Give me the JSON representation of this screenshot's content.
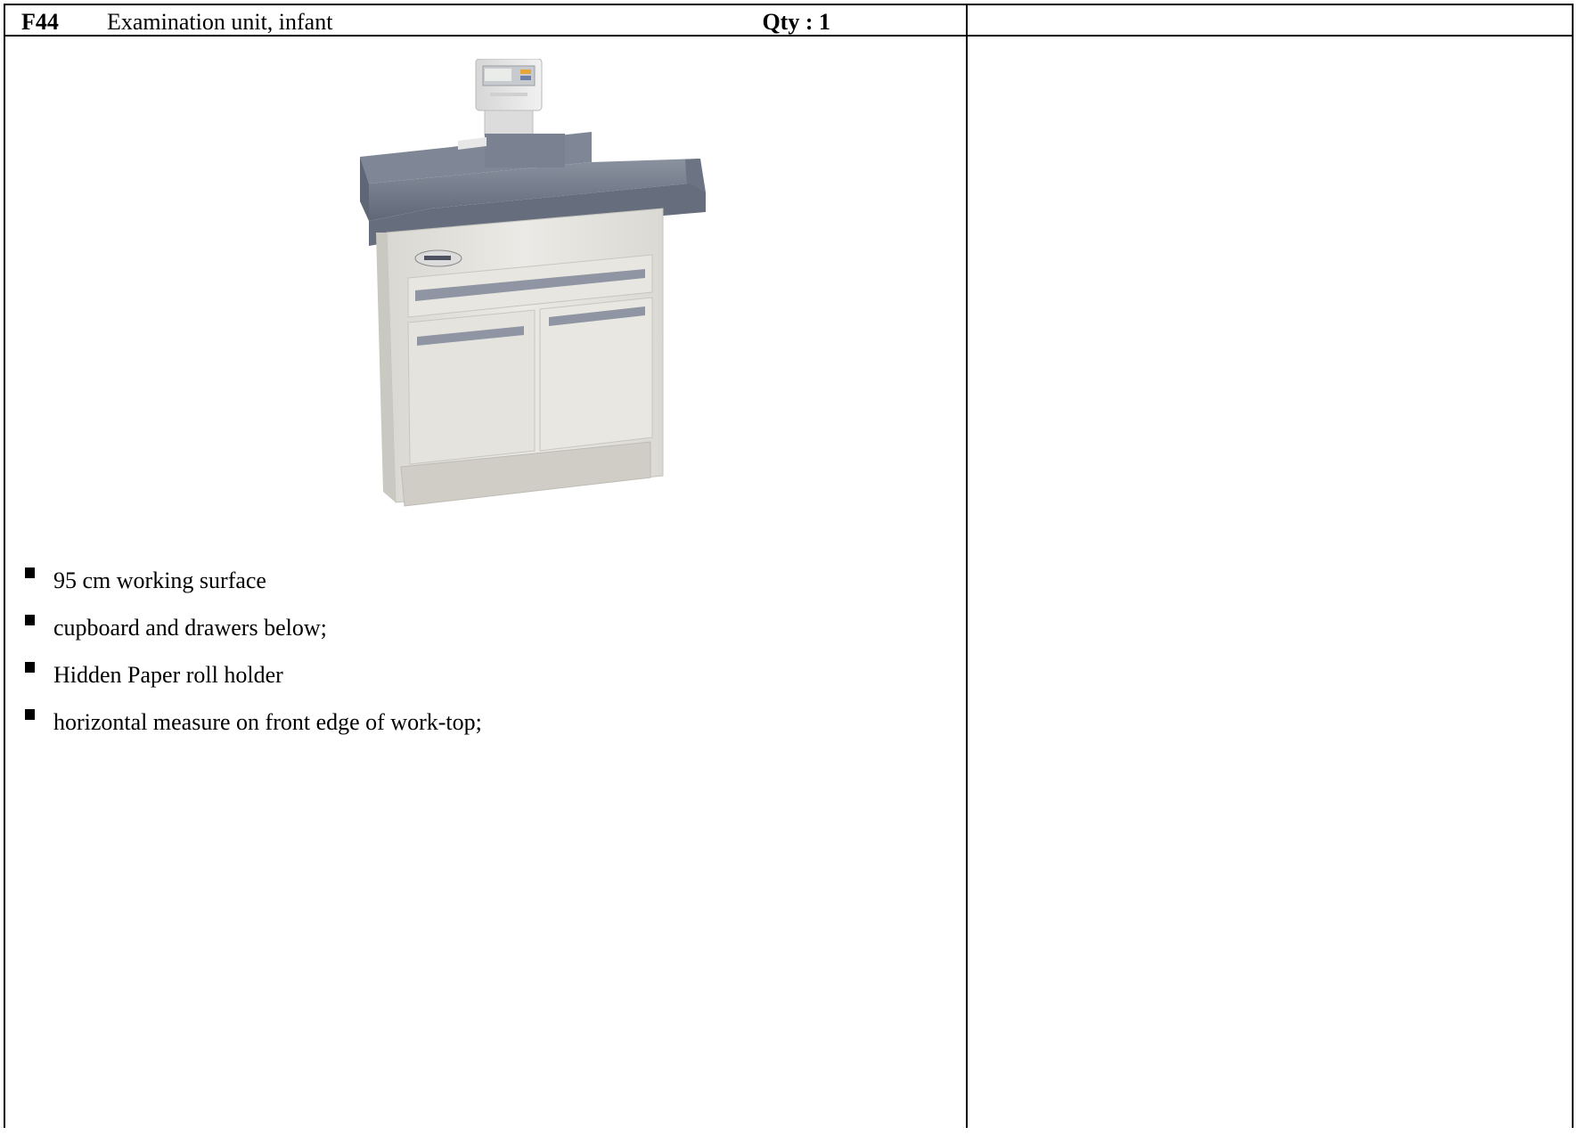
{
  "header": {
    "code": "F44",
    "title": "Examination unit, infant",
    "qty": "Qty : 1"
  },
  "image": {
    "subject": "infant examination unit with scale, tray top, drawer and two-door cupboard",
    "colors": {
      "tray": "#6f7787",
      "cabinet": "#e3e2dd",
      "handle": "#8d93a0",
      "plinth": "#cfcdc6"
    }
  },
  "features": [
    "95 cm working surface",
    "cupboard and drawers below;",
    "Hidden Paper roll holder",
    "horizontal measure on front edge of work-top;"
  ]
}
